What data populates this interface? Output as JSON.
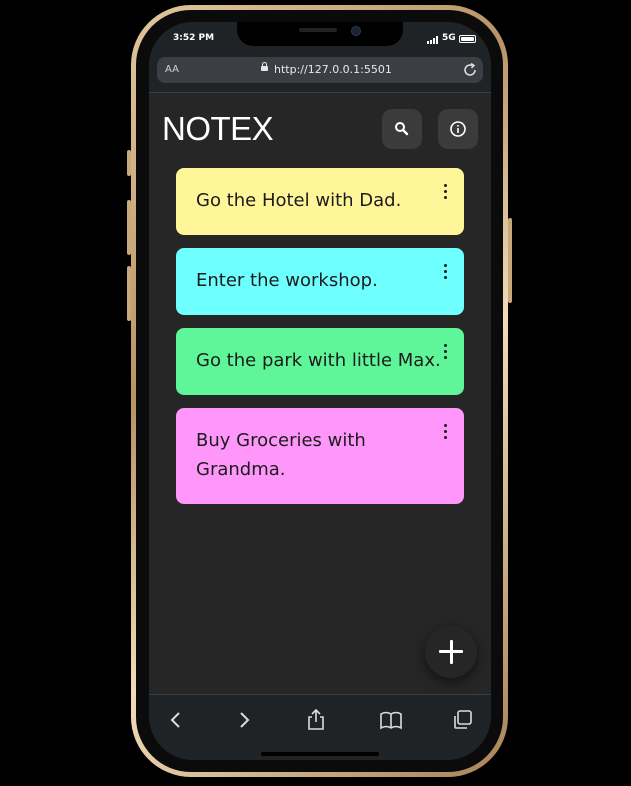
{
  "status_bar": {
    "time": "3:52 PM",
    "network": "5G"
  },
  "browser": {
    "text_size_label": "AA",
    "url": "http://127.0.0.1:5501"
  },
  "app": {
    "title": "NOTEX"
  },
  "notes": [
    {
      "text": "Go the Hotel with Dad.",
      "color": "#fff599"
    },
    {
      "text": "Enter the workshop.",
      "color": "#6effff"
    },
    {
      "text": "Go the park with little Max.",
      "color": "#5ff69a"
    },
    {
      "text": "Buy Groceries with Grandma.",
      "color": "#ff96fa"
    }
  ],
  "icons": {
    "header": [
      "search-icon",
      "info-icon"
    ],
    "note_menu": "more-vertical-icon",
    "fab": "plus-icon",
    "toolbar": [
      "back-icon",
      "forward-icon",
      "share-icon",
      "bookmarks-icon",
      "tabs-icon"
    ]
  },
  "colors": {
    "app_background": "#262626",
    "header_button": "#3b3b3b",
    "browser_chrome": "#1f2326"
  }
}
